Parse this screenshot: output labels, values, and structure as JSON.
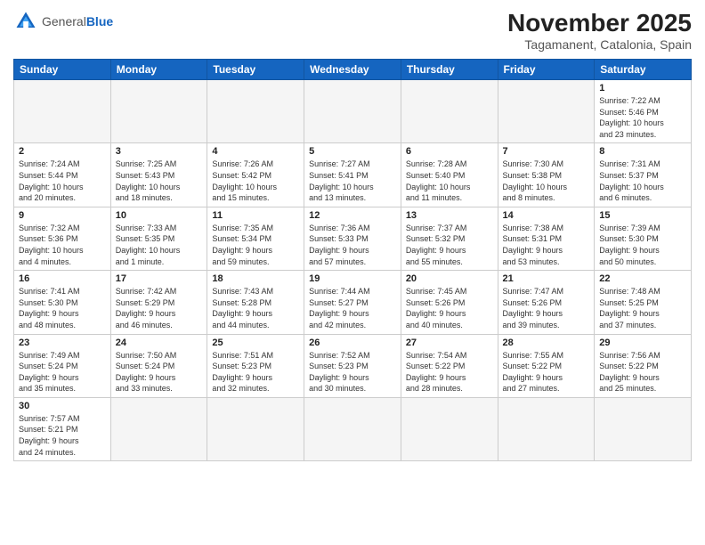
{
  "header": {
    "logo_general": "General",
    "logo_blue": "Blue",
    "month_title": "November 2025",
    "location": "Tagamanent, Catalonia, Spain"
  },
  "weekdays": [
    "Sunday",
    "Monday",
    "Tuesday",
    "Wednesday",
    "Thursday",
    "Friday",
    "Saturday"
  ],
  "weeks": [
    [
      {
        "day": "",
        "info": ""
      },
      {
        "day": "",
        "info": ""
      },
      {
        "day": "",
        "info": ""
      },
      {
        "day": "",
        "info": ""
      },
      {
        "day": "",
        "info": ""
      },
      {
        "day": "",
        "info": ""
      },
      {
        "day": "1",
        "info": "Sunrise: 7:22 AM\nSunset: 5:46 PM\nDaylight: 10 hours\nand 23 minutes."
      }
    ],
    [
      {
        "day": "2",
        "info": "Sunrise: 7:24 AM\nSunset: 5:44 PM\nDaylight: 10 hours\nand 20 minutes."
      },
      {
        "day": "3",
        "info": "Sunrise: 7:25 AM\nSunset: 5:43 PM\nDaylight: 10 hours\nand 18 minutes."
      },
      {
        "day": "4",
        "info": "Sunrise: 7:26 AM\nSunset: 5:42 PM\nDaylight: 10 hours\nand 15 minutes."
      },
      {
        "day": "5",
        "info": "Sunrise: 7:27 AM\nSunset: 5:41 PM\nDaylight: 10 hours\nand 13 minutes."
      },
      {
        "day": "6",
        "info": "Sunrise: 7:28 AM\nSunset: 5:40 PM\nDaylight: 10 hours\nand 11 minutes."
      },
      {
        "day": "7",
        "info": "Sunrise: 7:30 AM\nSunset: 5:38 PM\nDaylight: 10 hours\nand 8 minutes."
      },
      {
        "day": "8",
        "info": "Sunrise: 7:31 AM\nSunset: 5:37 PM\nDaylight: 10 hours\nand 6 minutes."
      }
    ],
    [
      {
        "day": "9",
        "info": "Sunrise: 7:32 AM\nSunset: 5:36 PM\nDaylight: 10 hours\nand 4 minutes."
      },
      {
        "day": "10",
        "info": "Sunrise: 7:33 AM\nSunset: 5:35 PM\nDaylight: 10 hours\nand 1 minute."
      },
      {
        "day": "11",
        "info": "Sunrise: 7:35 AM\nSunset: 5:34 PM\nDaylight: 9 hours\nand 59 minutes."
      },
      {
        "day": "12",
        "info": "Sunrise: 7:36 AM\nSunset: 5:33 PM\nDaylight: 9 hours\nand 57 minutes."
      },
      {
        "day": "13",
        "info": "Sunrise: 7:37 AM\nSunset: 5:32 PM\nDaylight: 9 hours\nand 55 minutes."
      },
      {
        "day": "14",
        "info": "Sunrise: 7:38 AM\nSunset: 5:31 PM\nDaylight: 9 hours\nand 53 minutes."
      },
      {
        "day": "15",
        "info": "Sunrise: 7:39 AM\nSunset: 5:30 PM\nDaylight: 9 hours\nand 50 minutes."
      }
    ],
    [
      {
        "day": "16",
        "info": "Sunrise: 7:41 AM\nSunset: 5:30 PM\nDaylight: 9 hours\nand 48 minutes."
      },
      {
        "day": "17",
        "info": "Sunrise: 7:42 AM\nSunset: 5:29 PM\nDaylight: 9 hours\nand 46 minutes."
      },
      {
        "day": "18",
        "info": "Sunrise: 7:43 AM\nSunset: 5:28 PM\nDaylight: 9 hours\nand 44 minutes."
      },
      {
        "day": "19",
        "info": "Sunrise: 7:44 AM\nSunset: 5:27 PM\nDaylight: 9 hours\nand 42 minutes."
      },
      {
        "day": "20",
        "info": "Sunrise: 7:45 AM\nSunset: 5:26 PM\nDaylight: 9 hours\nand 40 minutes."
      },
      {
        "day": "21",
        "info": "Sunrise: 7:47 AM\nSunset: 5:26 PM\nDaylight: 9 hours\nand 39 minutes."
      },
      {
        "day": "22",
        "info": "Sunrise: 7:48 AM\nSunset: 5:25 PM\nDaylight: 9 hours\nand 37 minutes."
      }
    ],
    [
      {
        "day": "23",
        "info": "Sunrise: 7:49 AM\nSunset: 5:24 PM\nDaylight: 9 hours\nand 35 minutes."
      },
      {
        "day": "24",
        "info": "Sunrise: 7:50 AM\nSunset: 5:24 PM\nDaylight: 9 hours\nand 33 minutes."
      },
      {
        "day": "25",
        "info": "Sunrise: 7:51 AM\nSunset: 5:23 PM\nDaylight: 9 hours\nand 32 minutes."
      },
      {
        "day": "26",
        "info": "Sunrise: 7:52 AM\nSunset: 5:23 PM\nDaylight: 9 hours\nand 30 minutes."
      },
      {
        "day": "27",
        "info": "Sunrise: 7:54 AM\nSunset: 5:22 PM\nDaylight: 9 hours\nand 28 minutes."
      },
      {
        "day": "28",
        "info": "Sunrise: 7:55 AM\nSunset: 5:22 PM\nDaylight: 9 hours\nand 27 minutes."
      },
      {
        "day": "29",
        "info": "Sunrise: 7:56 AM\nSunset: 5:22 PM\nDaylight: 9 hours\nand 25 minutes."
      }
    ],
    [
      {
        "day": "30",
        "info": "Sunrise: 7:57 AM\nSunset: 5:21 PM\nDaylight: 9 hours\nand 24 minutes."
      },
      {
        "day": "",
        "info": ""
      },
      {
        "day": "",
        "info": ""
      },
      {
        "day": "",
        "info": ""
      },
      {
        "day": "",
        "info": ""
      },
      {
        "day": "",
        "info": ""
      },
      {
        "day": "",
        "info": ""
      }
    ]
  ]
}
